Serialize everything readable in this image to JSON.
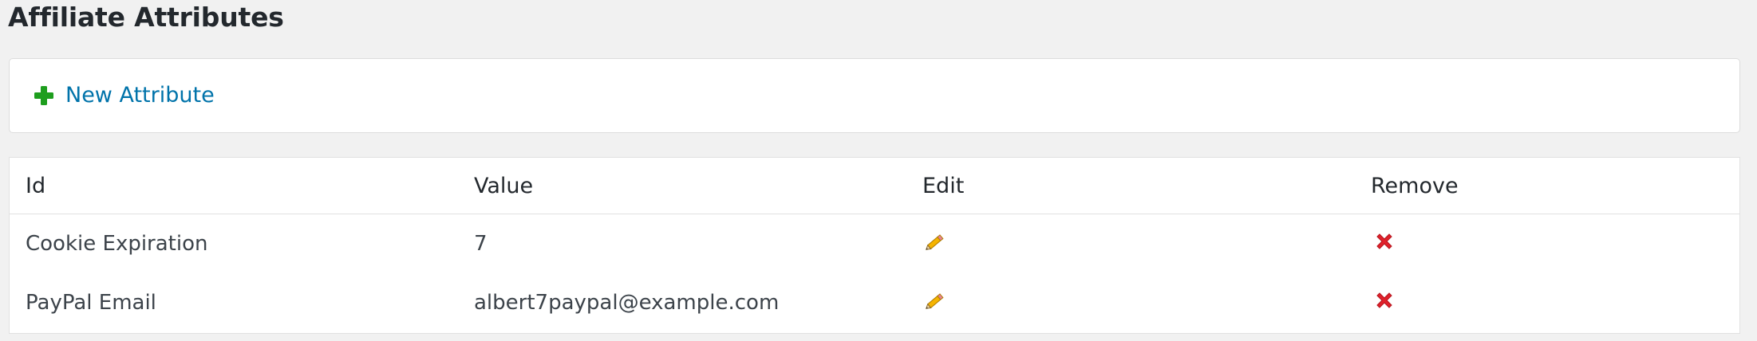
{
  "page": {
    "title": "Affiliate Attributes"
  },
  "actions": {
    "new_attribute_label": "New Attribute",
    "new_attribute_icon": "plus-icon",
    "plus_color": "#1e9e1e"
  },
  "table": {
    "columns": [
      "Id",
      "Value",
      "Edit",
      "Remove"
    ],
    "rows": [
      {
        "id": "Cookie Expiration",
        "value": "7",
        "edit_icon": "pencil-icon",
        "remove_icon": "close-icon"
      },
      {
        "id": "PayPal Email",
        "value": "albert7paypal@example.com",
        "edit_icon": "pencil-icon",
        "remove_icon": "close-icon"
      }
    ]
  },
  "colors": {
    "link": "#0073aa",
    "remove": "#e0212b",
    "background": "#f1f1f1"
  }
}
